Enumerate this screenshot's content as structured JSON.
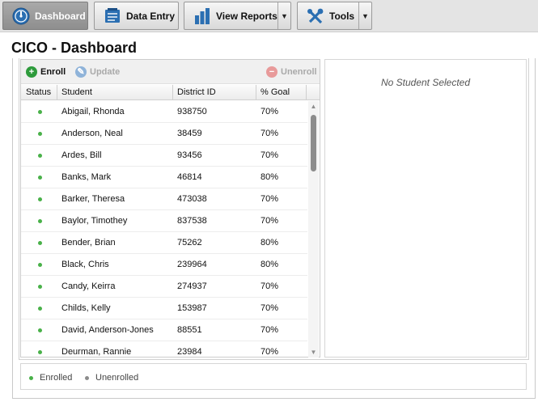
{
  "toolbar": {
    "dashboard_label": "Dashboard",
    "data_entry_label": "Data Entry",
    "view_reports_label": "View Reports",
    "tools_label": "Tools"
  },
  "page": {
    "title": "CICO - Dashboard"
  },
  "actions": {
    "enroll": "Enroll",
    "update": "Update",
    "unenroll": "Unenroll"
  },
  "columns": {
    "status": "Status",
    "student": "Student",
    "district_id": "District ID",
    "goal": "% Goal"
  },
  "students": [
    {
      "name": "Abigail, Rhonda",
      "id": "938750",
      "goal": "70%",
      "status": "enrolled"
    },
    {
      "name": "Anderson, Neal",
      "id": "38459",
      "goal": "70%",
      "status": "enrolled"
    },
    {
      "name": "Ardes, Bill",
      "id": "93456",
      "goal": "70%",
      "status": "enrolled"
    },
    {
      "name": "Banks, Mark",
      "id": "46814",
      "goal": "80%",
      "status": "enrolled"
    },
    {
      "name": "Barker, Theresa",
      "id": "473038",
      "goal": "70%",
      "status": "enrolled"
    },
    {
      "name": "Baylor, Timothey",
      "id": "837538",
      "goal": "70%",
      "status": "enrolled"
    },
    {
      "name": "Bender, Brian",
      "id": "75262",
      "goal": "80%",
      "status": "enrolled"
    },
    {
      "name": "Black, Chris",
      "id": "239964",
      "goal": "80%",
      "status": "enrolled"
    },
    {
      "name": "Candy, Keirra",
      "id": "274937",
      "goal": "70%",
      "status": "enrolled"
    },
    {
      "name": "Childs, Kelly",
      "id": "153987",
      "goal": "70%",
      "status": "enrolled"
    },
    {
      "name": "David, Anderson-Jones",
      "id": "88551",
      "goal": "70%",
      "status": "enrolled"
    },
    {
      "name": "Deurman, Rannie",
      "id": "23984",
      "goal": "70%",
      "status": "enrolled"
    }
  ],
  "detail": {
    "empty_message": "No Student Selected"
  },
  "legend": {
    "enrolled": "Enrolled",
    "unenrolled": "Unenrolled"
  },
  "colors": {
    "enrolled": "#49b149",
    "unenrolled": "#8c8c8c",
    "enroll_accent": "#2e9b3c",
    "update_accent": "#8fb3d9",
    "unenroll_accent": "#e07a7a"
  }
}
